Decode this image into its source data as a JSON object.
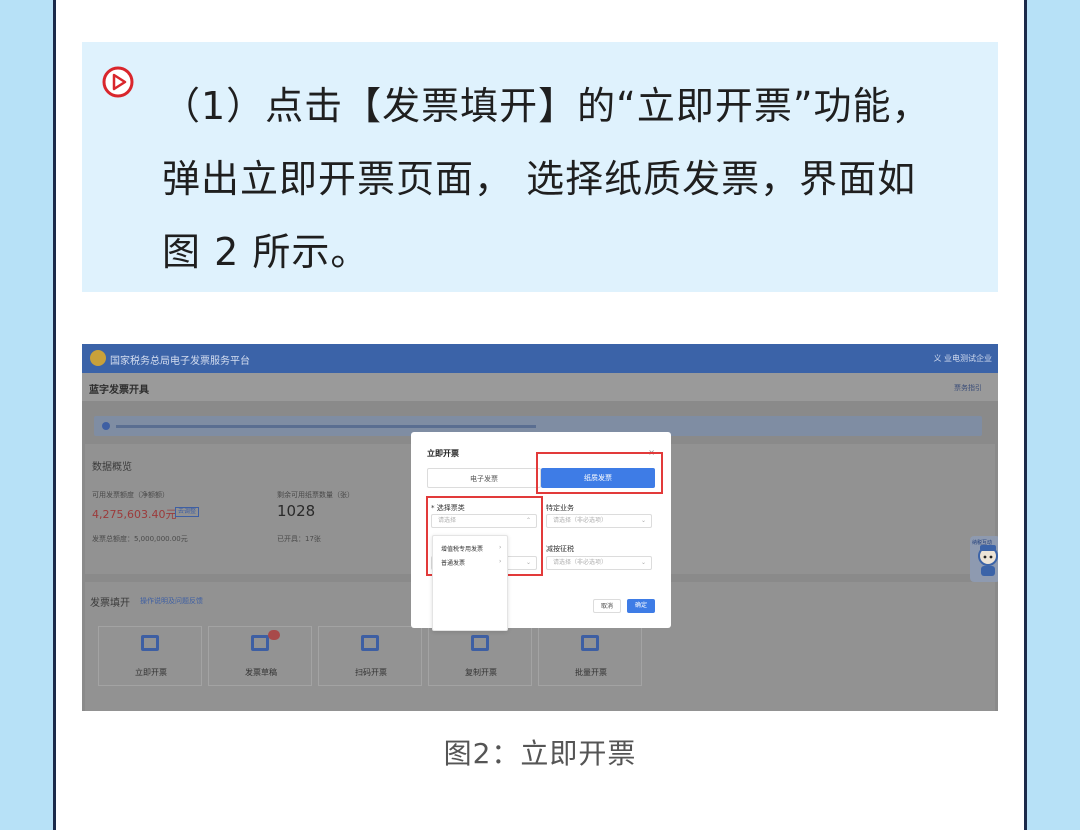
{
  "instruction": {
    "line1": "（1）点击【发票填开】的“立即开票”功能，",
    "line2": "弹出立即开票页面， 选择纸质发票，界面如",
    "line3": "图 2 所示。"
  },
  "screenshot": {
    "header_title": "国家税务总局电子发票服务平台",
    "header_user": "义 业电测试企业",
    "page_title": "蓝字发票开具",
    "page_link": "票务指引",
    "overview_title": "数据概览",
    "quota_label": "可用发票额度（净额额）",
    "quota_value": "4,275,603.40元",
    "quota_tag": "去调整",
    "paper_count_label": "剩余可用纸票数量（张）",
    "paper_count_value": "1028",
    "total_quota": "发票总额度：5,000,000.00元",
    "issued": "已开具：17张",
    "fill_title": "发票填开",
    "fill_link": "操作说明及问题反馈",
    "tiles": [
      "立即开票",
      "发票草稿",
      "扫码开票",
      "复制开票",
      "批量开票"
    ],
    "dialog": {
      "title": "立即开票",
      "close": "×",
      "option_electronic": "电子发票",
      "option_paper": "纸质发票",
      "ticket_type_label": "* 选择票类",
      "ticket_type_placeholder": "请选择",
      "special_business_label": "特定业务",
      "special_business_placeholder": "请选择（非必选项）",
      "tax_label": "减按征税",
      "tax_placeholder": "请选择（非必选项）",
      "dropdown_items": [
        "增值税专用发票",
        "普通发票"
      ],
      "cancel": "取消",
      "confirm": "确定"
    },
    "mascot_text": "纳税互动"
  },
  "caption": "图2：立即开票",
  "colors": {
    "page_bg": "#b7e1f7",
    "instruction_bg": "#dff2fd",
    "highlight": "#e23a3a",
    "primary": "#3e7ce6",
    "header": "#3b63a8"
  }
}
